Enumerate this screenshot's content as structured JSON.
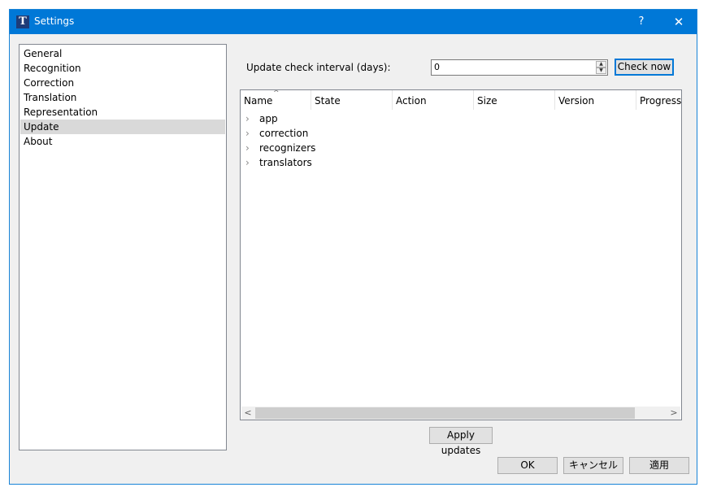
{
  "window": {
    "title": "Settings",
    "help": "?",
    "close": "✕",
    "icon_letter": "T"
  },
  "nav": {
    "items": [
      "General",
      "Recognition",
      "Correction",
      "Translation",
      "Representation",
      "Update",
      "About"
    ],
    "selected": "Update"
  },
  "update": {
    "interval_label": "Update check interval (days):",
    "interval_value": "0",
    "check_now": "Check now",
    "columns": [
      "Name",
      "State",
      "Action",
      "Size",
      "Version",
      "Progress"
    ],
    "rows": [
      "app",
      "correction",
      "recognizers",
      "translators"
    ],
    "apply_updates": "Apply updates"
  },
  "footer": {
    "ok": "OK",
    "cancel": "キャンセル",
    "apply": "適用"
  },
  "colors": {
    "titlebar": "#0078d7",
    "selected_nav": "#d9d9d9",
    "dialog_bg": "#f0f0f0"
  }
}
